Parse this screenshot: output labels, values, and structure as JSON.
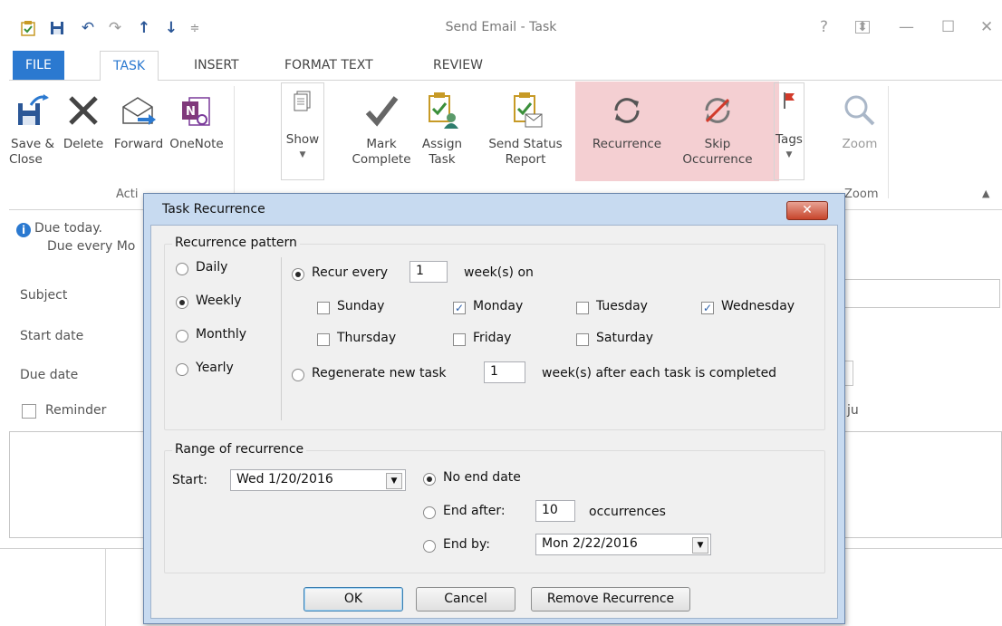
{
  "window": {
    "title": "Send Email - Task",
    "controls": {
      "help": "?",
      "ribbon_options": "⊼",
      "minimize": "—",
      "maximize": "☐",
      "close": "✕"
    }
  },
  "quick_access": [
    "task-app-icon",
    "save-icon",
    "undo-icon",
    "redo-icon",
    "previous-item-icon",
    "next-item-icon",
    "customize-icon"
  ],
  "tabs": [
    {
      "label": "FILE",
      "state": "file"
    },
    {
      "label": "TASK",
      "state": "active"
    },
    {
      "label": "INSERT"
    },
    {
      "label": "FORMAT TEXT"
    },
    {
      "label": "REVIEW"
    }
  ],
  "ribbon": {
    "save_close": [
      "Save &",
      "Close"
    ],
    "delete": "Delete",
    "forward": "Forward",
    "onenote": "OneNote",
    "show": "Show",
    "mark_complete": [
      "Mark",
      "Complete"
    ],
    "assign_task": [
      "Assign",
      "Task"
    ],
    "send_status": [
      "Send Status",
      "Report"
    ],
    "recurrence": "Recurrence",
    "skip_occurrence": [
      "Skip",
      "Occurrence"
    ],
    "tags": "Tags",
    "zoom": "Zoom",
    "group_actions": "Acti",
    "group_zoom": "Zoom",
    "highlight_color": "#f4cfd2"
  },
  "form": {
    "info_line1": "Due today.",
    "info_line2": "Due every Mo",
    "subject_label": "Subject",
    "start_label": "Start date",
    "due_label": "Due date",
    "reminder_label": "Reminder",
    "owner_fragment": "ju"
  },
  "dialog": {
    "title": "Task Recurrence",
    "close": "✕",
    "pattern": {
      "title": "Recurrence pattern",
      "types": [
        {
          "label": "Daily",
          "selected": false
        },
        {
          "label": "Weekly",
          "selected": true
        },
        {
          "label": "Monthly",
          "selected": false
        },
        {
          "label": "Yearly",
          "selected": false
        }
      ],
      "recur_every_label": "Recur every",
      "recur_every_value": "1",
      "recur_every_suffix": "week(s) on",
      "days": [
        {
          "label": "Sunday",
          "checked": false
        },
        {
          "label": "Monday",
          "checked": true
        },
        {
          "label": "Tuesday",
          "checked": false
        },
        {
          "label": "Wednesday",
          "checked": true
        },
        {
          "label": "Thursday",
          "checked": false
        },
        {
          "label": "Friday",
          "checked": false
        },
        {
          "label": "Saturday",
          "checked": false
        }
      ],
      "regenerate_label": "Regenerate new task",
      "regenerate_value": "1",
      "regenerate_suffix": "week(s) after each task is completed"
    },
    "range": {
      "title": "Range of recurrence",
      "start_label": "Start:",
      "start_value": "Wed 1/20/2016",
      "no_end_label": "No end date",
      "end_after_label": "End after:",
      "end_after_value": "10",
      "occurrences_label": "occurrences",
      "end_by_label": "End by:",
      "end_by_value": "Mon 2/22/2016"
    },
    "buttons": {
      "ok": "OK",
      "cancel": "Cancel",
      "remove": "Remove Recurrence"
    }
  }
}
